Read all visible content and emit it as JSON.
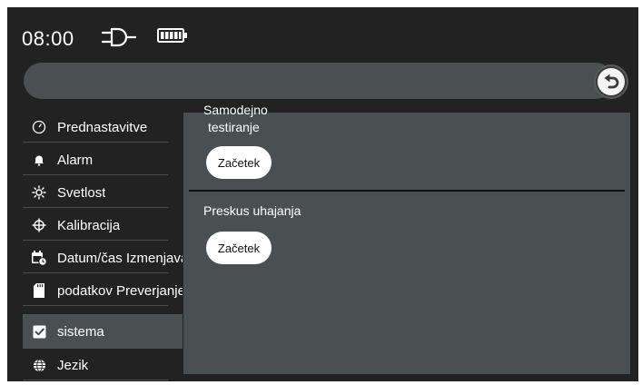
{
  "status_bar": {
    "time": "08:00",
    "plug_icon": "plug-icon",
    "battery_icon": "battery-icon"
  },
  "header": {
    "back_icon": "back-arrow-icon"
  },
  "sidebar": {
    "items": [
      {
        "label": "Prednastavitve",
        "icon": "gauge-icon"
      },
      {
        "label": "Alarm",
        "icon": "bell-icon"
      },
      {
        "label": "Svetlost",
        "icon": "sun-icon"
      },
      {
        "label": "Kalibracija",
        "icon": "crosshair-icon"
      },
      {
        "label": "Datum/čas Izmenjava",
        "icon": "calendar-clock-icon"
      },
      {
        "label": "podatkov Preverjanje",
        "icon": "sd-card-icon"
      },
      {
        "label": "sistema",
        "icon": "checkbox-icon",
        "active": true
      },
      {
        "label": "Jezik",
        "icon": "globe-icon"
      }
    ]
  },
  "main": {
    "self_test": {
      "title_line1": "Samodejno",
      "title_line2": "testiranje",
      "button_label": "Začetek"
    },
    "leak_test": {
      "title": "Preskus uhajanja",
      "button_label": "Začetek"
    }
  },
  "colors": {
    "background": "#222222",
    "panel": "#4a4f52",
    "button": "#ffffff",
    "text": "#ffffff"
  }
}
